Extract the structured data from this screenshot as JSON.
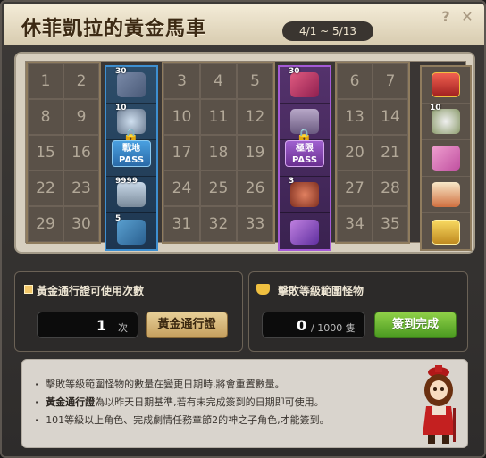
{
  "window": {
    "title": "休菲凱拉的黃金馬車",
    "date_range": "4/1 ~ 5/13",
    "help_glyph": "?",
    "close_glyph": "✕"
  },
  "board": {
    "groups": [
      {
        "numbers": [
          "1",
          "2",
          "8",
          "9",
          "15",
          "16",
          "22",
          "23",
          "29",
          "30"
        ]
      },
      {
        "numbers": [
          "3",
          "4",
          "5",
          "10",
          "11",
          "12",
          "17",
          "18",
          "19",
          "24",
          "25",
          "26",
          "31",
          "32",
          "33"
        ]
      },
      {
        "numbers": [
          "6",
          "7",
          "13",
          "14",
          "20",
          "21",
          "27",
          "28",
          "34",
          "35"
        ]
      }
    ],
    "pass_columns": [
      {
        "color": "blue",
        "badge_line1": "戰地",
        "badge_line2": "PASS",
        "qty_top": "30",
        "qty_2": "10",
        "qty_4": "9999",
        "qty_5": "5"
      },
      {
        "color": "purple",
        "badge_line1": "極限",
        "badge_line2": "PASS",
        "qty_top": "30",
        "qty_2": "",
        "qty_4": "3",
        "qty_5": ""
      }
    ],
    "rewards": [
      {
        "icon": "chest-red-icon"
      },
      {
        "icon": "gem-cluster-icon",
        "qty": "10"
      },
      {
        "icon": "gift-box-pink-icon"
      },
      {
        "icon": "sandwich-box-icon"
      },
      {
        "icon": "gold-box-icon"
      }
    ]
  },
  "left_panel": {
    "label": "黃金通行證可使用次數",
    "count": "1",
    "unit": "次",
    "button": "黃金通行證"
  },
  "right_panel": {
    "label": "擊敗等級範圍怪物",
    "count": "0",
    "total": "/ 1000 隻",
    "button": "簽到完成"
  },
  "info": {
    "line1": "擊敗等級範圍怪物的數量在變更日期時,將會重置數量。",
    "line2_bold": "黃金通行證",
    "line2_rest": "為以昨天日期基準,若有未完成簽到的日期即可使用。",
    "line3": "101等級以上角色、完成劇情任務章節2的神之子角色,才能簽到。"
  },
  "colors": {
    "accent_gold": "#c59f5e",
    "accent_green": "#4a9a20",
    "pass_blue": "#3e8fd0",
    "pass_purple": "#a45ad6"
  }
}
